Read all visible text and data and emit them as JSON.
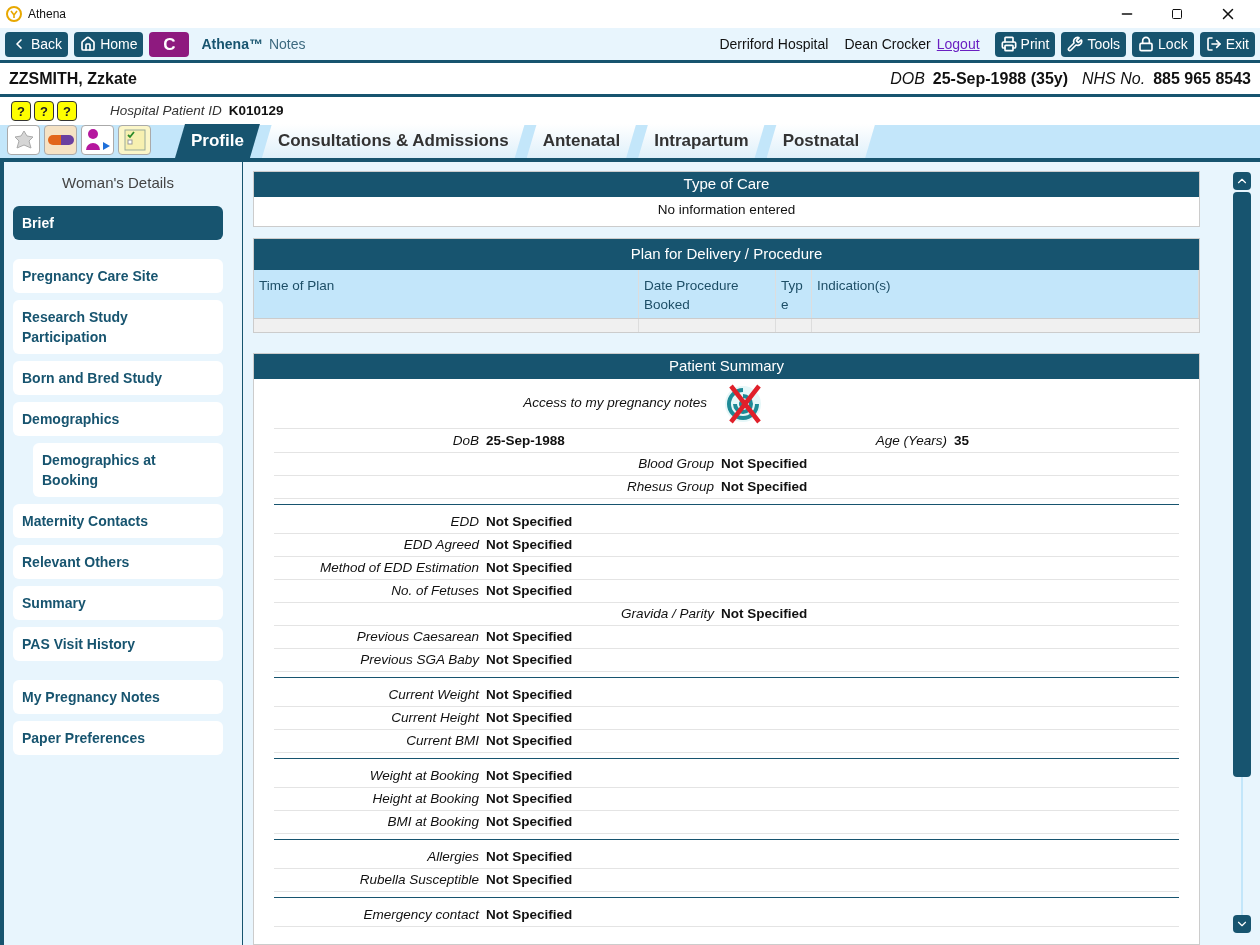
{
  "window": {
    "title": "Athena"
  },
  "toolbar": {
    "left_buttons": [
      {
        "kind": "back",
        "label": "Back"
      },
      {
        "kind": "home",
        "label": "Home"
      }
    ],
    "badge": "C",
    "app_name": "Athena™",
    "app_suffix": "Notes",
    "hospital": "Derriford Hospital",
    "user": "Dean Crocker",
    "logout": "Logout",
    "right_buttons": [
      {
        "kind": "print",
        "label": "Print"
      },
      {
        "kind": "tools",
        "label": "Tools"
      },
      {
        "kind": "lock",
        "label": "Lock"
      },
      {
        "kind": "exit",
        "label": "Exit"
      }
    ]
  },
  "help_buttons": [
    "?",
    "?",
    "?"
  ],
  "patient": {
    "name": "ZZSMITH, Zzkate",
    "dob_label": "DOB",
    "dob": "25-Sep-1988 (35y)",
    "nhs_label": "NHS No.",
    "nhs": "885 965 8543",
    "id_label": "Hospital Patient ID",
    "id": "K010129"
  },
  "tabs": [
    {
      "label": "Profile",
      "selected": true
    },
    {
      "label": "Consultations & Admissions",
      "selected": false
    },
    {
      "label": "Antenatal",
      "selected": false
    },
    {
      "label": "Intrapartum",
      "selected": false
    },
    {
      "label": "Postnatal",
      "selected": false
    }
  ],
  "sidebar": {
    "title": "Woman's Details",
    "groups": [
      [
        {
          "label": "Brief",
          "selected": true
        }
      ],
      [
        {
          "label": "Pregnancy Care Site",
          "selected": false
        },
        {
          "label": "Research Study Participation",
          "selected": false
        },
        {
          "label": "Born and Bred Study",
          "selected": false
        },
        {
          "label": "Demographics",
          "selected": false,
          "children": [
            {
              "label": "Demographics at Booking",
              "selected": false
            }
          ]
        },
        {
          "label": "Maternity Contacts",
          "selected": false
        },
        {
          "label": "Relevant Others",
          "selected": false
        },
        {
          "label": "Summary",
          "selected": false
        },
        {
          "label": "PAS Visit History",
          "selected": false
        }
      ],
      [
        {
          "label": "My Pregnancy Notes",
          "selected": false
        },
        {
          "label": "Paper Preferences",
          "selected": false
        }
      ]
    ]
  },
  "type_of_care": {
    "title": "Type of Care",
    "message": "No information entered"
  },
  "plan": {
    "title": "Plan for Delivery / Procedure",
    "columns": [
      "Time of Plan",
      "Date Procedure Booked",
      "Type",
      "Indication(s)"
    ]
  },
  "summary": {
    "title": "Patient Summary",
    "access": {
      "label": "Access to my pregnancy notes",
      "granted": false
    },
    "groups": [
      [
        {
          "first": {
            "label": "DoB",
            "value": "25-Sep-1988"
          },
          "third": {
            "label": "Age (Years)",
            "value": "35"
          }
        },
        {
          "second": {
            "label": "Blood Group",
            "value": "Not Specified"
          }
        },
        {
          "second": {
            "label": "Rhesus Group",
            "value": "Not Specified"
          }
        }
      ],
      [
        {
          "first": {
            "label": "EDD",
            "value": "Not Specified"
          }
        },
        {
          "first": {
            "label": "EDD Agreed",
            "value": "Not Specified"
          }
        },
        {
          "first": {
            "label": "Method of EDD Estimation",
            "value": "Not Specified"
          }
        },
        {
          "first": {
            "label": "No. of Fetuses",
            "value": "Not Specified"
          }
        },
        {
          "second": {
            "label": "Gravida / Parity",
            "value": "Not Specified"
          }
        },
        {
          "first": {
            "label": "Previous Caesarean",
            "value": "Not Specified"
          }
        },
        {
          "first": {
            "label": "Previous SGA Baby",
            "value": "Not Specified"
          }
        }
      ],
      [
        {
          "first": {
            "label": "Current Weight",
            "value": "Not Specified"
          }
        },
        {
          "first": {
            "label": "Current Height",
            "value": "Not Specified"
          }
        },
        {
          "first": {
            "label": "Current BMI",
            "value": "Not Specified"
          }
        }
      ],
      [
        {
          "first": {
            "label": "Weight at Booking",
            "value": "Not Specified"
          }
        },
        {
          "first": {
            "label": "Height at Booking",
            "value": "Not Specified"
          }
        },
        {
          "first": {
            "label": "BMI at Booking",
            "value": "Not Specified"
          }
        }
      ],
      [
        {
          "first": {
            "label": "Allergies",
            "value": "Not Specified"
          }
        },
        {
          "first": {
            "label": "Rubella Susceptible",
            "value": "Not Specified"
          }
        }
      ],
      [
        {
          "first": {
            "label": "Emergency contact",
            "value": "Not Specified"
          }
        }
      ]
    ]
  }
}
